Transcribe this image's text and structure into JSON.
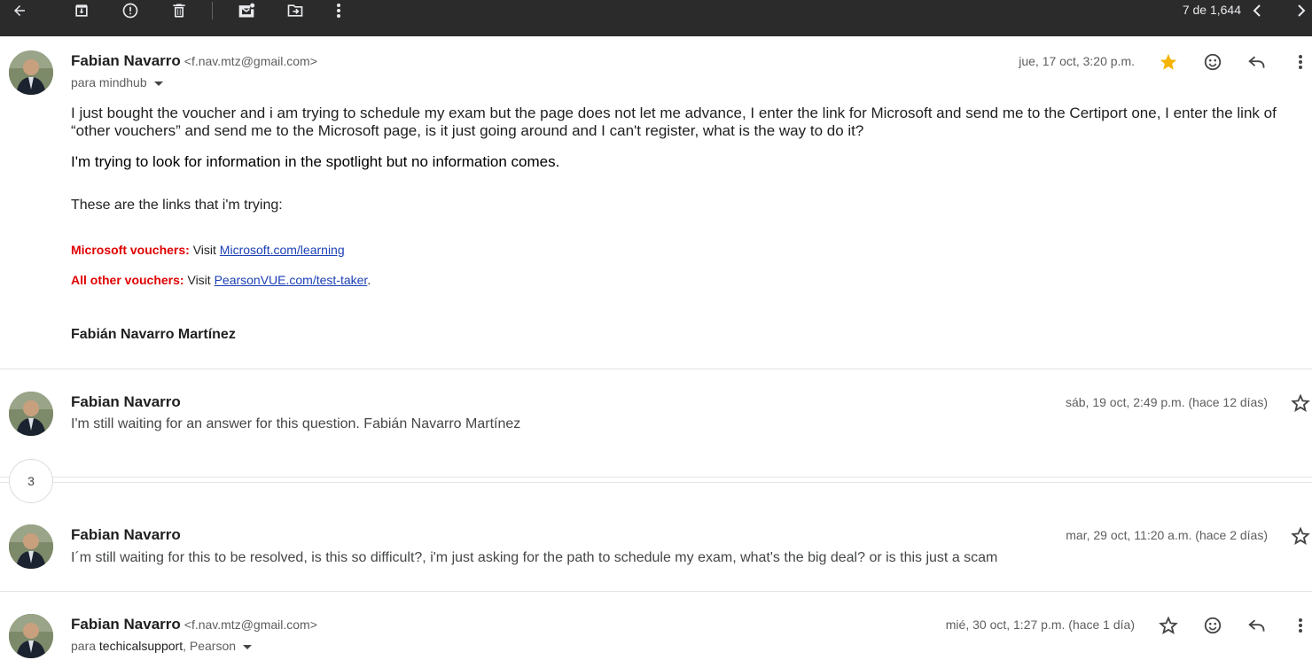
{
  "toolbar": {
    "count_text": "7 de 1,644",
    "icons": [
      "back-arrow-icon",
      "archive-icon",
      "report-spam-icon",
      "delete-icon",
      "mark-unread-icon",
      "move-to-icon",
      "more-vert-icon",
      "chevron-left-icon",
      "chevron-right-icon"
    ]
  },
  "messages": [
    {
      "sender": "Fabian Navarro",
      "email": "<f.nav.mtz@gmail.com>",
      "to_prefix": "para",
      "to_name": "mindhub",
      "date": "jue, 17 oct, 3:20 p.m.",
      "starred": true,
      "body_p1": "I just bought the voucher and i am trying to schedule my exam but the page does not let me advance, I enter the link for Microsoft and send me to the Certiport one, I enter the link of “other vouchers” and send me to the Microsoft page, is it just going around and I can't register, what is the way to do it?",
      "body_p2": "I'm trying to look for information in the spotlight but no information comes.",
      "body_p3": "These are the links that i'm trying:",
      "voucher1_label": "Microsoft vouchers:",
      "voucher1_visit": "Visit",
      "voucher1_link": "Microsoft.com/learning",
      "voucher2_label": "All other vouchers:",
      "voucher2_visit": "Visit",
      "voucher2_link": "PearsonVUE.com/test-taker",
      "voucher2_period": ".",
      "signature": "Fabián Navarro Martínez"
    },
    {
      "sender": "Fabian Navarro",
      "date": "sáb, 19 oct, 2:49 p.m. (hace 12 días)",
      "snippet": "I'm still waiting for an answer for this question. Fabián Navarro Martínez"
    },
    {
      "sender": "Fabian Navarro",
      "date": "mar, 29 oct, 11:20 a.m. (hace 2 días)",
      "snippet": "I´m still waiting for this to be resolved, is this so difficult?, i'm just asking for the path to schedule my exam, what's the big deal? or is this just a scam"
    },
    {
      "sender": "Fabian Navarro",
      "email": "<f.nav.mtz@gmail.com>",
      "to_prefix": "para",
      "to_name": "techicalsupport",
      "to_extra": ", Pearson",
      "date": "mié, 30 oct, 1:27 p.m. (hace 1 día)"
    }
  ],
  "collapsed_count": "3",
  "colors": {
    "toolbar_bg": "#2b2b2b",
    "star_filled": "#f4b400",
    "voucher_label": "#e00000",
    "link": "#1a3fb5"
  }
}
